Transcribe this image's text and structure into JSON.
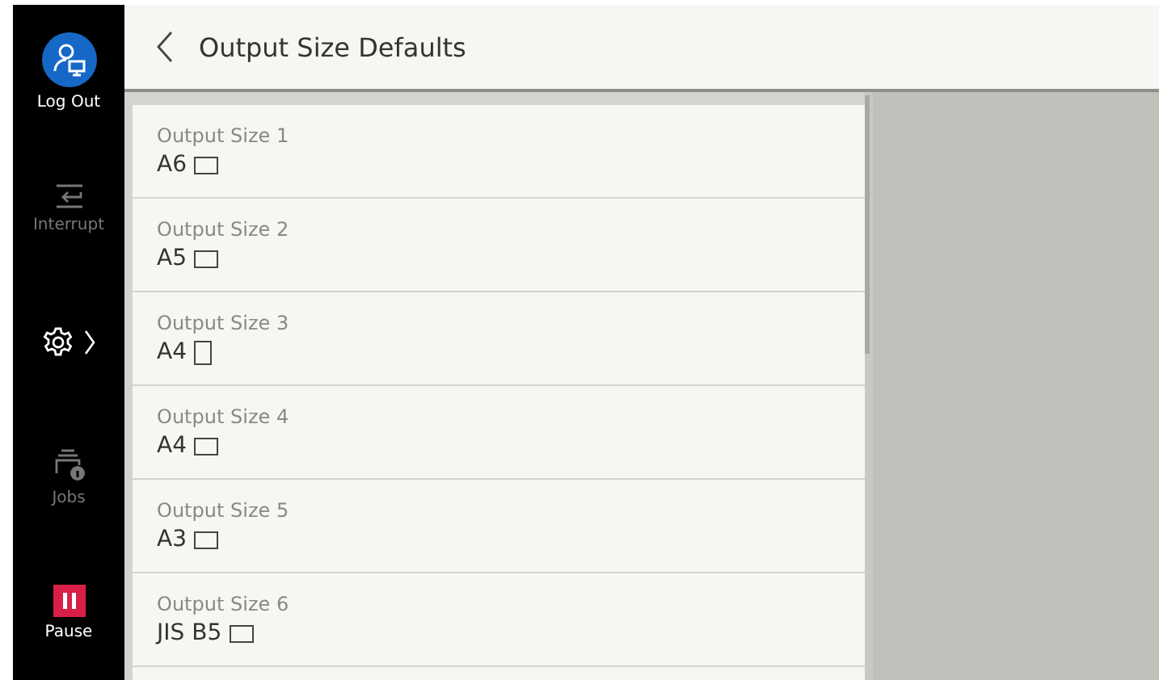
{
  "sidebar": {
    "items": [
      {
        "kind": "logout",
        "label": "Log Out",
        "disabled": false
      },
      {
        "kind": "interrupt",
        "label": "Interrupt",
        "disabled": true
      },
      {
        "kind": "settings",
        "selected": true
      },
      {
        "kind": "jobs",
        "label": "Jobs",
        "disabled": true
      },
      {
        "kind": "pause",
        "label": "Pause",
        "disabled": false
      }
    ]
  },
  "header": {
    "title": "Output Size Defaults"
  },
  "list": {
    "items": [
      {
        "label": "Output Size 1",
        "value": "A6",
        "kind": "landscape"
      },
      {
        "label": "Output Size 2",
        "value": "A5",
        "kind": "landscape"
      },
      {
        "label": "Output Size 3",
        "value": "A4",
        "kind": "portrait"
      },
      {
        "label": "Output Size 4",
        "value": "A4",
        "kind": "landscape"
      },
      {
        "label": "Output Size 5",
        "value": "A3",
        "kind": "landscape"
      },
      {
        "label": "Output Size 6",
        "value": "JIS B5",
        "kind": "landscape"
      }
    ]
  }
}
